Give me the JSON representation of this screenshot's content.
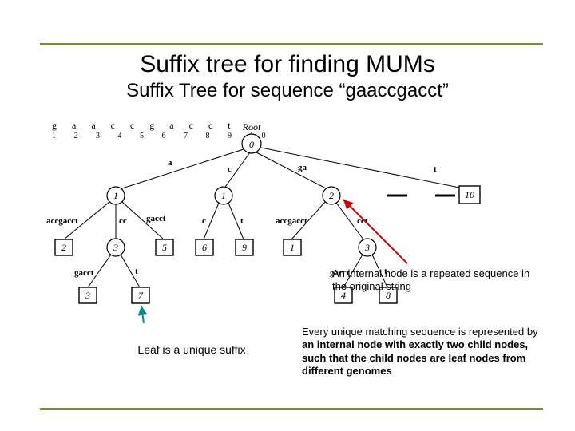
{
  "title": "Suffix tree for finding MUMs",
  "subtitle": "Suffix Tree for sequence “gaaccgacct”",
  "sequence": {
    "letters": "g a a c c g a c c t",
    "indices": "1 2 3 4 5 6 7 8 9 10"
  },
  "root_label": "Root",
  "nodes": {
    "root": "0",
    "i1": "1",
    "i2": "1",
    "i3": "2",
    "l_a_accgacct": "2",
    "i_a_cc": "3",
    "l_a_gacct": "5",
    "l_c_c": "6",
    "l_c_t": "9",
    "l_ga_accgacct": "1",
    "i_ga_cct": "3",
    "l_t": "10",
    "l_acc_gacct": "3",
    "l_acc_t": "7",
    "l_gacct_gacct": "4",
    "l_gacct_t": "8"
  },
  "edges": {
    "a": "a",
    "c": "c",
    "ga": "ga",
    "t": "t",
    "accgacct1": "accgacct",
    "cc": "cc",
    "gacct1": "gacct",
    "c2": "c",
    "t2": "t",
    "accgacct2": "accgacct",
    "cct": "cct",
    "gacct2": "gacct",
    "t3": "t",
    "gacct3": "gacct",
    "t4": "t"
  },
  "note_internal": "An internal node is a repeated sequence in the original string",
  "note_leaf": "Leaf is a unique suffix",
  "note_mum_pre": "Every unique matching sequence is represented by ",
  "note_mum_bold": "an internal node with exactly two child nodes, such that the child nodes are leaf nodes from different genomes",
  "chart_data": {
    "type": "tree",
    "title": "Suffix Tree for sequence gaaccgacct",
    "sequence": "gaaccgacct",
    "root": {
      "id": 0,
      "kind": "internal",
      "label": "Root",
      "children": [
        {
          "edge": "a",
          "id": 1,
          "kind": "internal",
          "children": [
            {
              "edge": "accgacct",
              "id": 2,
              "kind": "leaf"
            },
            {
              "edge": "cc",
              "id": 3,
              "kind": "internal",
              "children": [
                {
                  "edge": "gacct",
                  "id": 3,
                  "kind": "leaf"
                },
                {
                  "edge": "t",
                  "id": 7,
                  "kind": "leaf"
                }
              ]
            },
            {
              "edge": "gacct",
              "id": 5,
              "kind": "leaf"
            }
          ]
        },
        {
          "edge": "c",
          "id": 1,
          "kind": "internal",
          "children": [
            {
              "edge": "c",
              "id": 6,
              "kind": "leaf"
            },
            {
              "edge": "t",
              "id": 9,
              "kind": "leaf"
            }
          ]
        },
        {
          "edge": "ga",
          "id": 2,
          "kind": "internal",
          "children": [
            {
              "edge": "accgacct",
              "id": 1,
              "kind": "leaf"
            },
            {
              "edge": "cct",
              "id": 3,
              "kind": "internal",
              "children": [
                {
                  "edge": "gacct",
                  "id": 4,
                  "kind": "leaf"
                },
                {
                  "edge": "t",
                  "id": 8,
                  "kind": "leaf"
                }
              ]
            }
          ]
        },
        {
          "edge": "t",
          "id": 10,
          "kind": "leaf"
        }
      ]
    }
  }
}
